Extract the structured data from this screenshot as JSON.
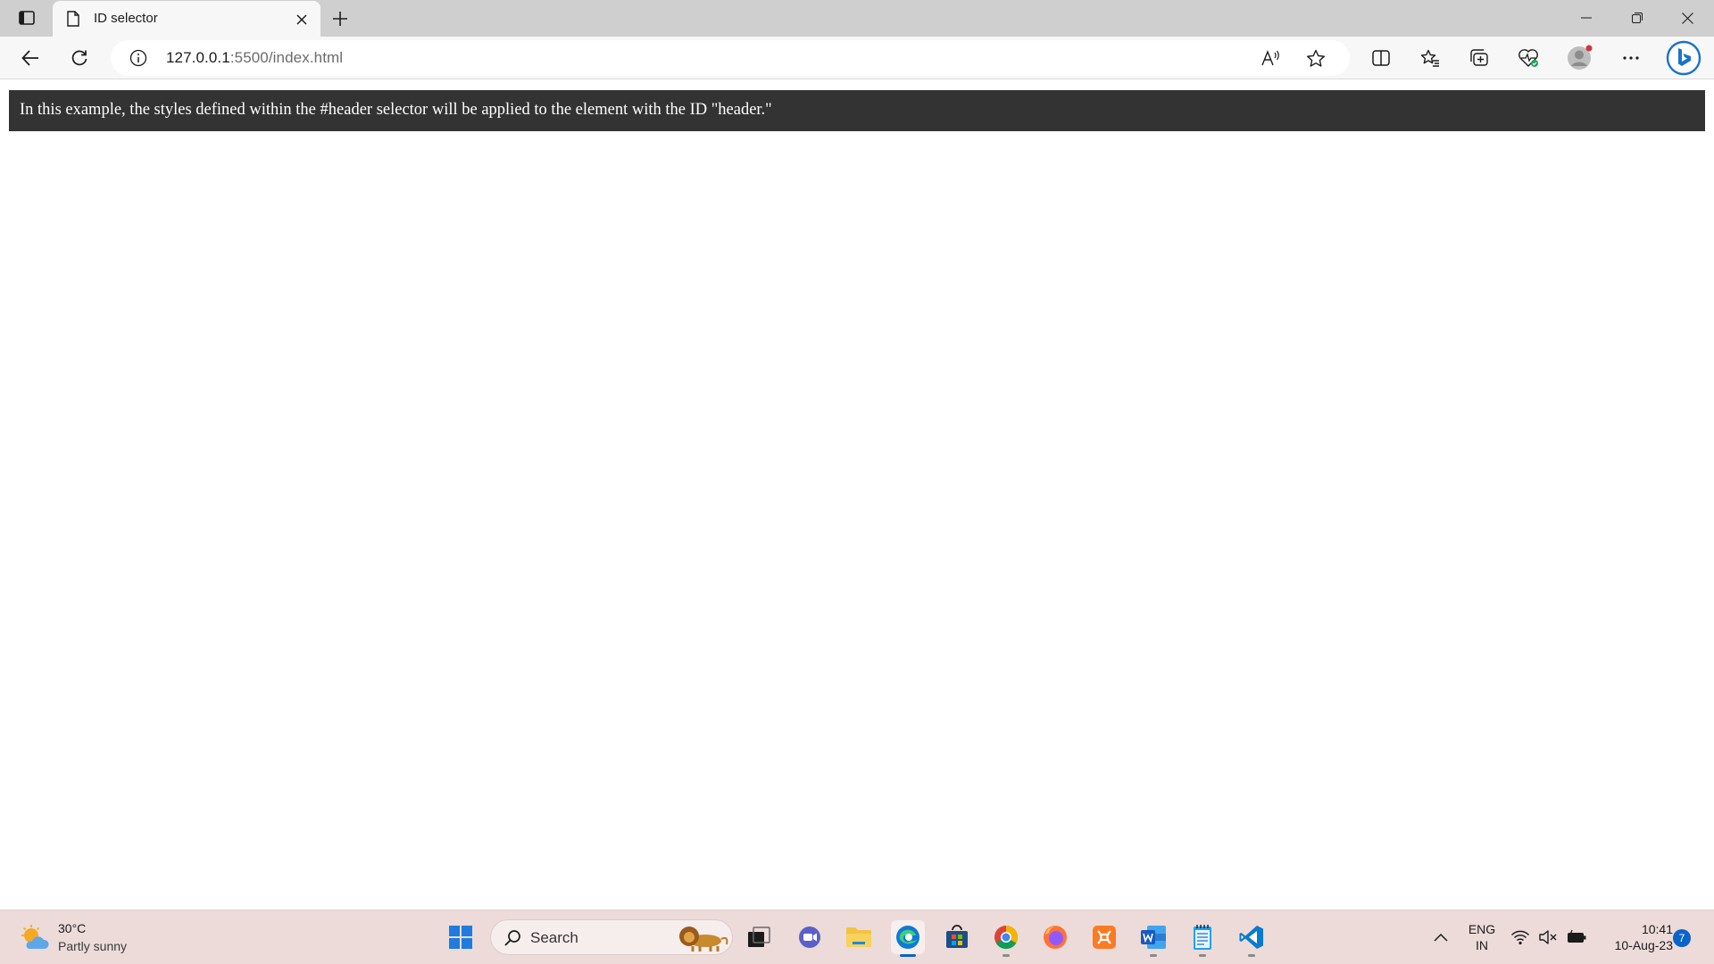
{
  "browser": {
    "tab": {
      "title": "ID selector"
    },
    "address": {
      "host": "127.0.0.1",
      "rest": ":5500/index.html"
    }
  },
  "page": {
    "header_text": "In this example, the styles defined within the #header selector will be applied to the element with the ID \"header.\""
  },
  "taskbar": {
    "weather": {
      "temp": "30°C",
      "desc": "Partly sunny"
    },
    "search_placeholder": "Search",
    "tray": {
      "lang_1": "ENG",
      "lang_2": "IN",
      "time": "10:41",
      "date": "10-Aug-23",
      "notifications": "7"
    }
  },
  "colors": {
    "header_bg": "#333333",
    "accent": "#0a63c9",
    "taskbar_bg": "#ecdbd9"
  }
}
